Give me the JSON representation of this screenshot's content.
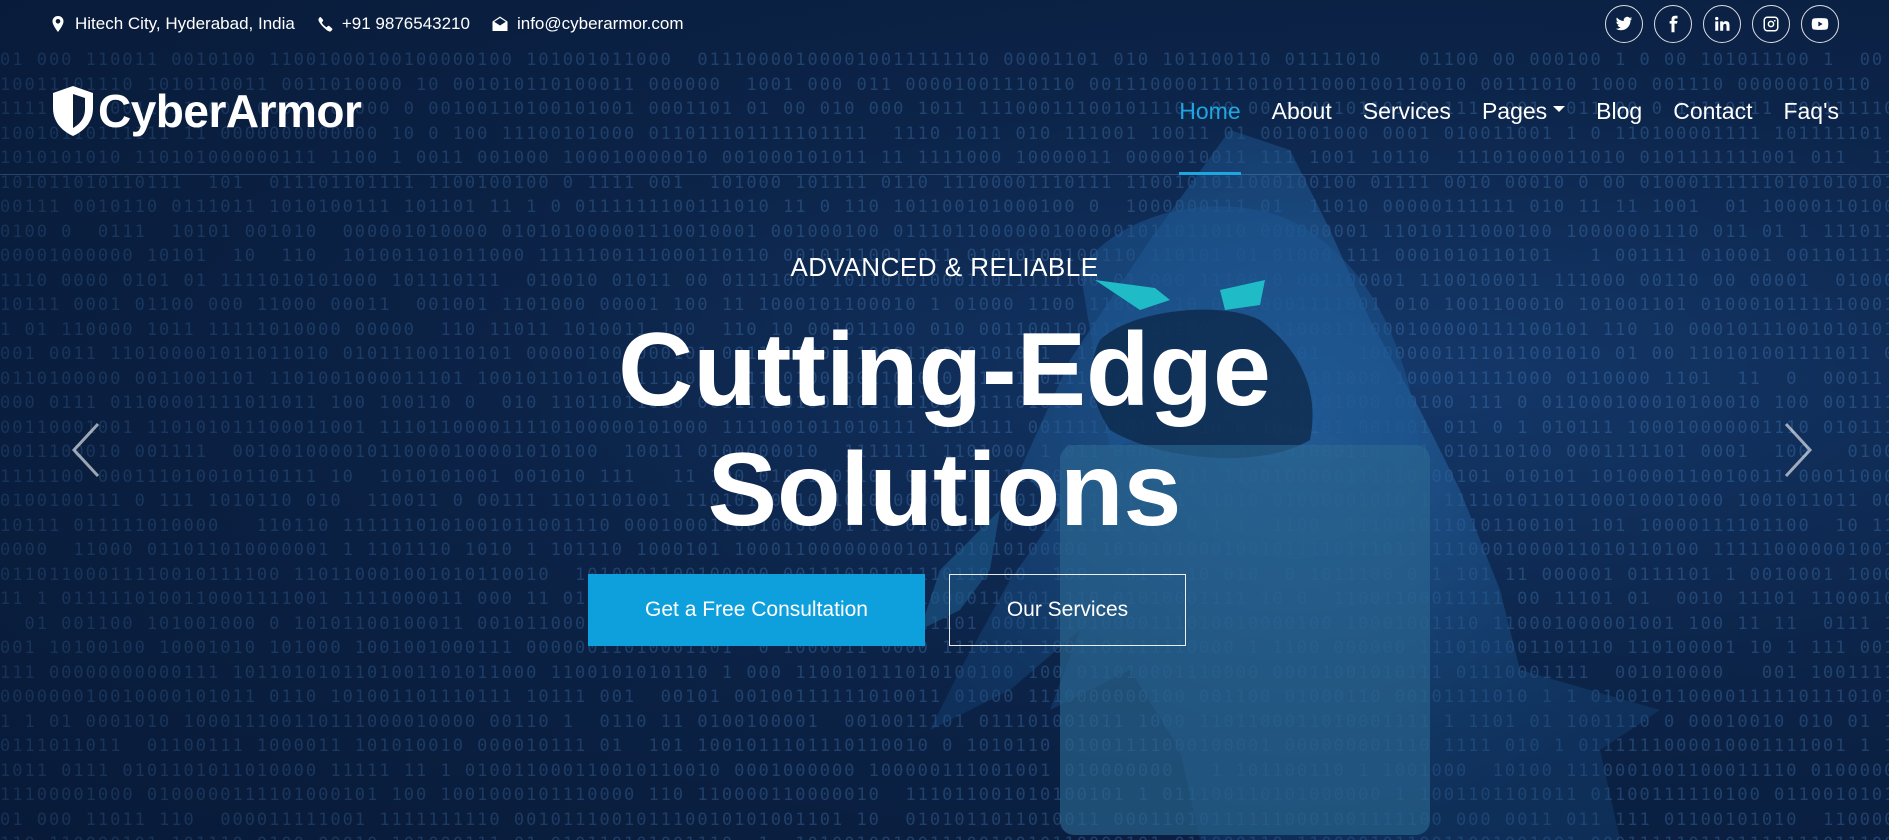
{
  "topbar": {
    "address": "Hitech City, Hyderabad, India",
    "phone": "+91 9876543210",
    "email": "info@cyberarmor.com",
    "socials": [
      "twitter-icon",
      "facebook-icon",
      "linkedin-icon",
      "instagram-icon",
      "youtube-icon"
    ]
  },
  "brand": {
    "name": "CyberArmor"
  },
  "nav": {
    "items": [
      {
        "label": "Home",
        "active": true
      },
      {
        "label": "About"
      },
      {
        "label": "Services"
      },
      {
        "label": "Pages",
        "dropdown": true
      },
      {
        "label": "Blog"
      },
      {
        "label": "Contact"
      },
      {
        "label": "Faq's"
      }
    ]
  },
  "hero": {
    "kicker": "ADVANCED & RELIABLE",
    "headline_line1": "Cutting-Edge",
    "headline_line2": "Solutions",
    "primary_button": "Get a Free Consultation",
    "secondary_button": "Our Services"
  },
  "colors": {
    "accent": "#0ea0dc",
    "background": "#0a1d3d"
  }
}
